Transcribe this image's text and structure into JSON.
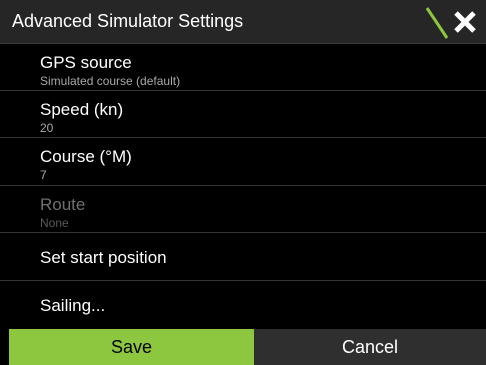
{
  "dialog": {
    "title": "Advanced Simulator Settings",
    "close_icon": "close-icon"
  },
  "settings": [
    {
      "label": "GPS source",
      "value": "Simulated course (default)",
      "enabled": true
    },
    {
      "label": "Speed (kn)",
      "value": "20",
      "enabled": true
    },
    {
      "label": "Course (°M)",
      "value": "7",
      "enabled": true
    },
    {
      "label": "Route",
      "value": "None",
      "enabled": false
    },
    {
      "label": "Set start position",
      "enabled": true
    },
    {
      "label": "Sailing...",
      "enabled": true
    }
  ],
  "footer": {
    "save_label": "Save",
    "cancel_label": "Cancel"
  },
  "colors": {
    "accent": "#8dc63f",
    "title_bar": "#262626",
    "background": "#000000",
    "secondary_text": "#a8a8a8",
    "disabled_text": "#6f6f6f"
  }
}
